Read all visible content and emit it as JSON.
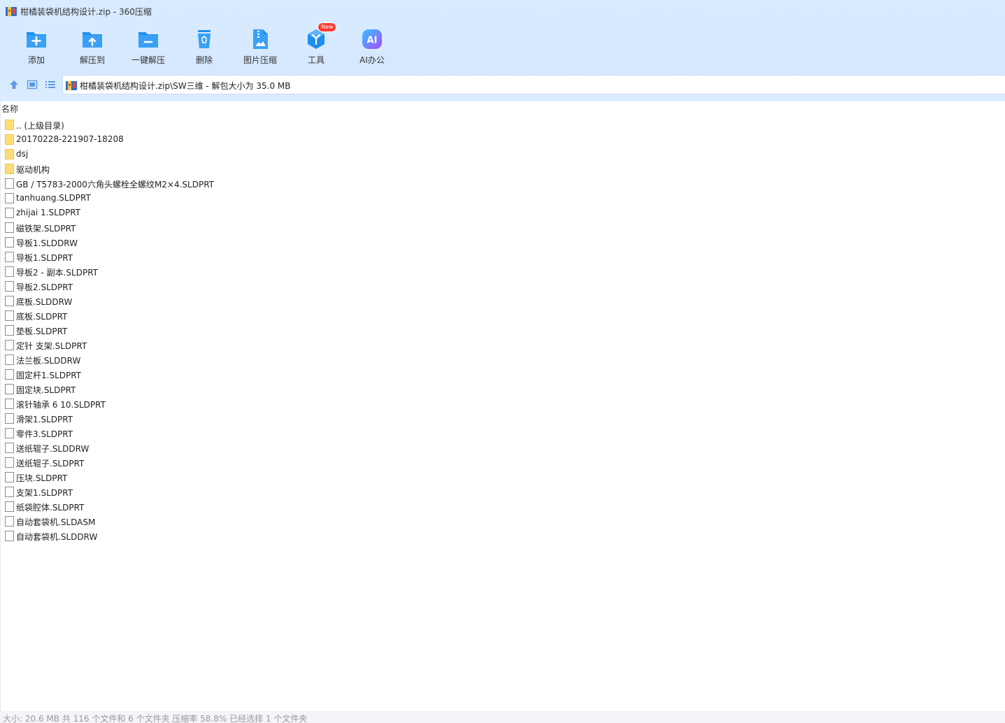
{
  "window": {
    "title": "柑橘装袋机结构设计.zip - 360压缩"
  },
  "toolbar": {
    "items": [
      {
        "label": "添加",
        "icon": "add-folder-icon"
      },
      {
        "label": "解压到",
        "icon": "extract-to-icon"
      },
      {
        "label": "一键解压",
        "icon": "one-click-extract-icon"
      },
      {
        "label": "删除",
        "icon": "recycle-bin-icon"
      },
      {
        "label": "图片压缩",
        "icon": "image-compress-icon"
      },
      {
        "label": "工具",
        "icon": "tools-cube-icon",
        "badge": "New"
      },
      {
        "label": "AI办公",
        "icon": "ai-office-icon"
      }
    ]
  },
  "nav": {
    "address": "柑橘装袋机结构设计.zip\\SW三维 - 解包大小为 35.0 MB"
  },
  "list": {
    "column_name": "名称",
    "items": [
      {
        "name": ".. (上级目录)",
        "type": "folder"
      },
      {
        "name": "20170228-221907-18208",
        "type": "folder"
      },
      {
        "name": "dsj",
        "type": "folder"
      },
      {
        "name": "驱动机构",
        "type": "folder"
      },
      {
        "name": "GB / T5783-2000六角头螺栓全螺纹M2×4.SLDPRT",
        "type": "file"
      },
      {
        "name": "tanhuang.SLDPRT",
        "type": "file"
      },
      {
        "name": "zhijai 1.SLDPRT",
        "type": "file"
      },
      {
        "name": "磁铁架.SLDPRT",
        "type": "file"
      },
      {
        "name": "导板1.SLDDRW",
        "type": "file"
      },
      {
        "name": "导板1.SLDPRT",
        "type": "file"
      },
      {
        "name": "导板2 - 副本.SLDPRT",
        "type": "file"
      },
      {
        "name": "导板2.SLDPRT",
        "type": "file"
      },
      {
        "name": "底板.SLDDRW",
        "type": "file"
      },
      {
        "name": "底板.SLDPRT",
        "type": "file"
      },
      {
        "name": "垫板.SLDPRT",
        "type": "file"
      },
      {
        "name": "定针 支架.SLDPRT",
        "type": "file"
      },
      {
        "name": "法兰板.SLDDRW",
        "type": "file"
      },
      {
        "name": "固定杆1.SLDPRT",
        "type": "file"
      },
      {
        "name": "固定块.SLDPRT",
        "type": "file"
      },
      {
        "name": "滚针轴承 6  10.SLDPRT",
        "type": "file"
      },
      {
        "name": "滑架1.SLDPRT",
        "type": "file"
      },
      {
        "name": "零件3.SLDPRT",
        "type": "file"
      },
      {
        "name": "送纸辊子.SLDDRW",
        "type": "file"
      },
      {
        "name": "送纸辊子.SLDPRT",
        "type": "file"
      },
      {
        "name": "压块.SLDPRT",
        "type": "file"
      },
      {
        "name": "支架1.SLDPRT",
        "type": "file"
      },
      {
        "name": "纸袋腔体.SLDPRT",
        "type": "file"
      },
      {
        "name": "自动套袋机.SLDASM",
        "type": "file"
      },
      {
        "name": "自动套袋机.SLDDRW",
        "type": "file"
      }
    ]
  },
  "status": {
    "text": "大小: 20.6 MB 共 116 个文件和 6 个文件夹 压缩率 58.8% 已经选择 1 个文件夹"
  },
  "colors": {
    "accent": "#1e8ef0",
    "toolbar_bg": "#d7eafe",
    "folder": "#ffdc7a",
    "badge": "#ff3b30"
  }
}
